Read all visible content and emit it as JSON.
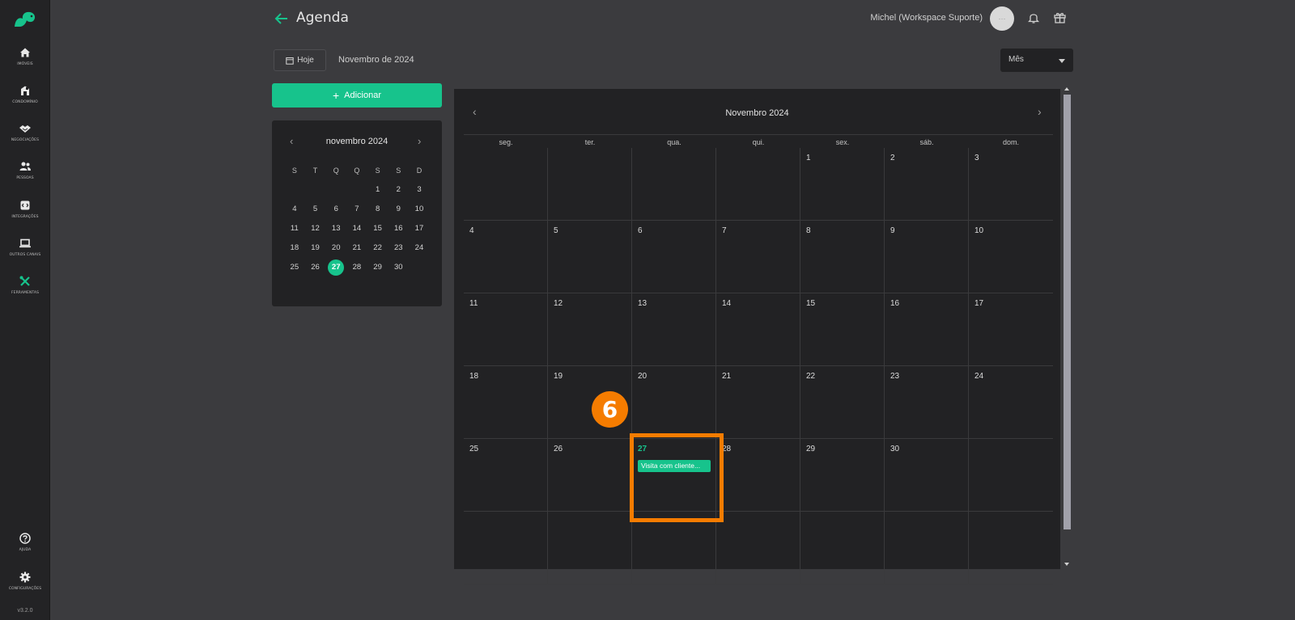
{
  "app": {
    "version": "v3.2.0"
  },
  "sidebar": {
    "items": [
      {
        "label": "Imóveis",
        "icon": "home-icon"
      },
      {
        "label": "Condomínio",
        "icon": "building-icon"
      },
      {
        "label": "Negociações",
        "icon": "handshake-icon"
      },
      {
        "label": "Pessoas",
        "icon": "people-icon"
      },
      {
        "label": "Integrações",
        "icon": "integration-icon"
      },
      {
        "label": "Outros canais",
        "icon": "laptop-icon"
      },
      {
        "label": "Ferramentas",
        "icon": "tools-icon"
      }
    ],
    "help_label": "Ajuda",
    "settings_label": "Configurações"
  },
  "header": {
    "title": "Agenda",
    "user_name": "Michel (Workspace Suporte)",
    "avatar_text": "···"
  },
  "toolbar": {
    "today_label": "Hoje",
    "current_month": "Novembro de 2024",
    "view_selected": "Mês",
    "add_label": "Adicionar"
  },
  "mini_calendar": {
    "title": "novembro 2024",
    "weekdays": [
      "S",
      "T",
      "Q",
      "Q",
      "S",
      "S",
      "D"
    ],
    "weeks": [
      [
        "",
        "",
        "",
        "",
        "1",
        "2",
        "3"
      ],
      [
        "4",
        "5",
        "6",
        "7",
        "8",
        "9",
        "10"
      ],
      [
        "11",
        "12",
        "13",
        "14",
        "15",
        "16",
        "17"
      ],
      [
        "18",
        "19",
        "20",
        "21",
        "22",
        "23",
        "24"
      ],
      [
        "25",
        "26",
        "27",
        "28",
        "29",
        "30",
        ""
      ]
    ],
    "selected": "27"
  },
  "calendar": {
    "title": "Novembro 2024",
    "weekdays": [
      "seg.",
      "ter.",
      "qua.",
      "qui.",
      "sex.",
      "sáb.",
      "dom."
    ],
    "weeks": [
      [
        "",
        "",
        "",
        "",
        "1",
        "2",
        "3"
      ],
      [
        "4",
        "5",
        "6",
        "7",
        "8",
        "9",
        "10"
      ],
      [
        "11",
        "12",
        "13",
        "14",
        "15",
        "16",
        "17"
      ],
      [
        "18",
        "19",
        "20",
        "21",
        "22",
        "23",
        "24"
      ],
      [
        "25",
        "26",
        "27",
        "28",
        "29",
        "30",
        ""
      ],
      [
        "",
        "",
        "",
        "",
        "",
        "",
        ""
      ]
    ],
    "today": "27",
    "events": [
      {
        "day": "27",
        "label": "Visita com cliente..."
      }
    ]
  },
  "annotation": {
    "step": "6",
    "color": "#f57c00"
  },
  "colors": {
    "accent": "#17c38c",
    "background": "#3b3b3e",
    "panel": "#222224"
  }
}
